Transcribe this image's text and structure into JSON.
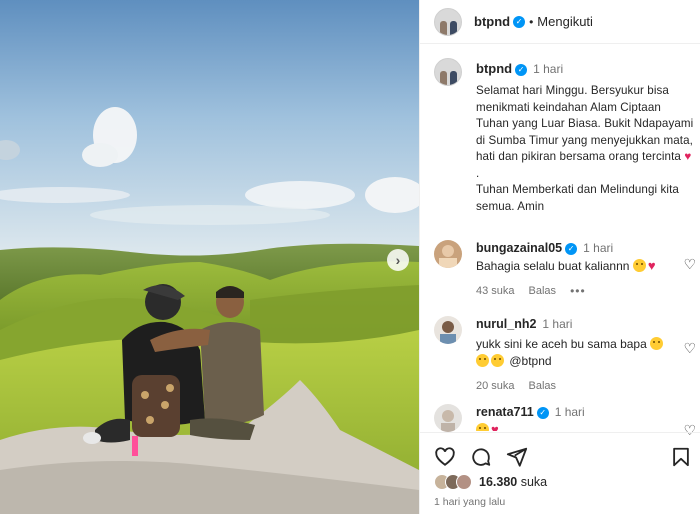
{
  "header": {
    "username": "btpnd",
    "separator": "•",
    "follow_status": "Mengikuti"
  },
  "photo": {
    "next_arrow": "›"
  },
  "caption": {
    "username": "btpnd",
    "time": "1 hari",
    "text": "Selamat hari Minggu. Bersyukur bisa menikmati keindahan Alam Ciptaan Tuhan yang Luar Biasa. Bukit Ndapayami di Sumba Timur yang menyejukkan mata, hati dan pikiran bersama orang tercinta",
    "heart": "♥",
    "text2": ".\nTuhan Memberkati dan Melindungi kita semua. Amin"
  },
  "comments": [
    {
      "username": "bungazainal05",
      "verified": true,
      "time": "1 hari",
      "text": "Bahagia selalu buat kalian",
      "text_suffix": "nn",
      "likes": "43 suka",
      "reply": "Balas",
      "more": "•••"
    },
    {
      "username": "nurul_nh2",
      "verified": false,
      "time": "1 hari",
      "text": "yukk sini ke aceh bu sama bapa",
      "mention": "@btpnd",
      "likes": "20 suka",
      "reply": "Balas"
    },
    {
      "username": "renata711",
      "verified": true,
      "time": "1 hari"
    }
  ],
  "footer": {
    "likes_count": "16.380",
    "likes_label": "suka",
    "posted_time": "1 hari yang lalu"
  },
  "icons": {
    "like": "heart-outline-icon",
    "comment": "comment-icon",
    "share": "share-icon",
    "save": "bookmark-icon"
  },
  "colors": {
    "verified": "#0095f6",
    "heart": "#e0245e",
    "muted": "#737373",
    "text": "#262626"
  }
}
